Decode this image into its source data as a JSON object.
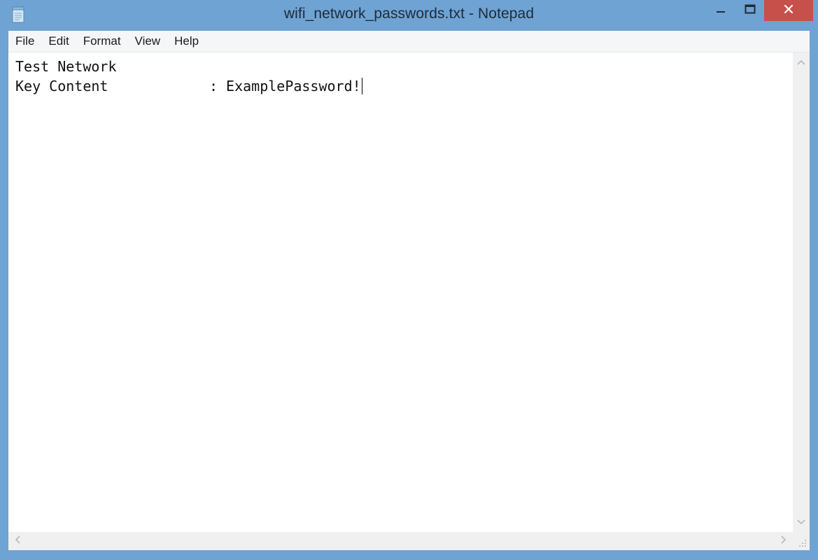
{
  "window": {
    "title": "wifi_network_passwords.txt - Notepad",
    "app_icon": "notepad-icon",
    "controls": {
      "minimize_icon": "minimize-icon",
      "maximize_icon": "maximize-icon",
      "close_icon": "close-icon"
    },
    "colors": {
      "frame": "#6ea3d3",
      "close_button": "#c7504b"
    }
  },
  "menu": {
    "items": [
      "File",
      "Edit",
      "Format",
      "View",
      "Help"
    ]
  },
  "editor": {
    "lines": [
      "Test Network",
      "Key Content            : ExamplePassword!"
    ]
  },
  "scrollbars": {
    "up_icon": "chevron-up-icon",
    "down_icon": "chevron-down-icon",
    "left_icon": "chevron-left-icon",
    "right_icon": "chevron-right-icon",
    "grip_icon": "resize-grip-icon"
  }
}
